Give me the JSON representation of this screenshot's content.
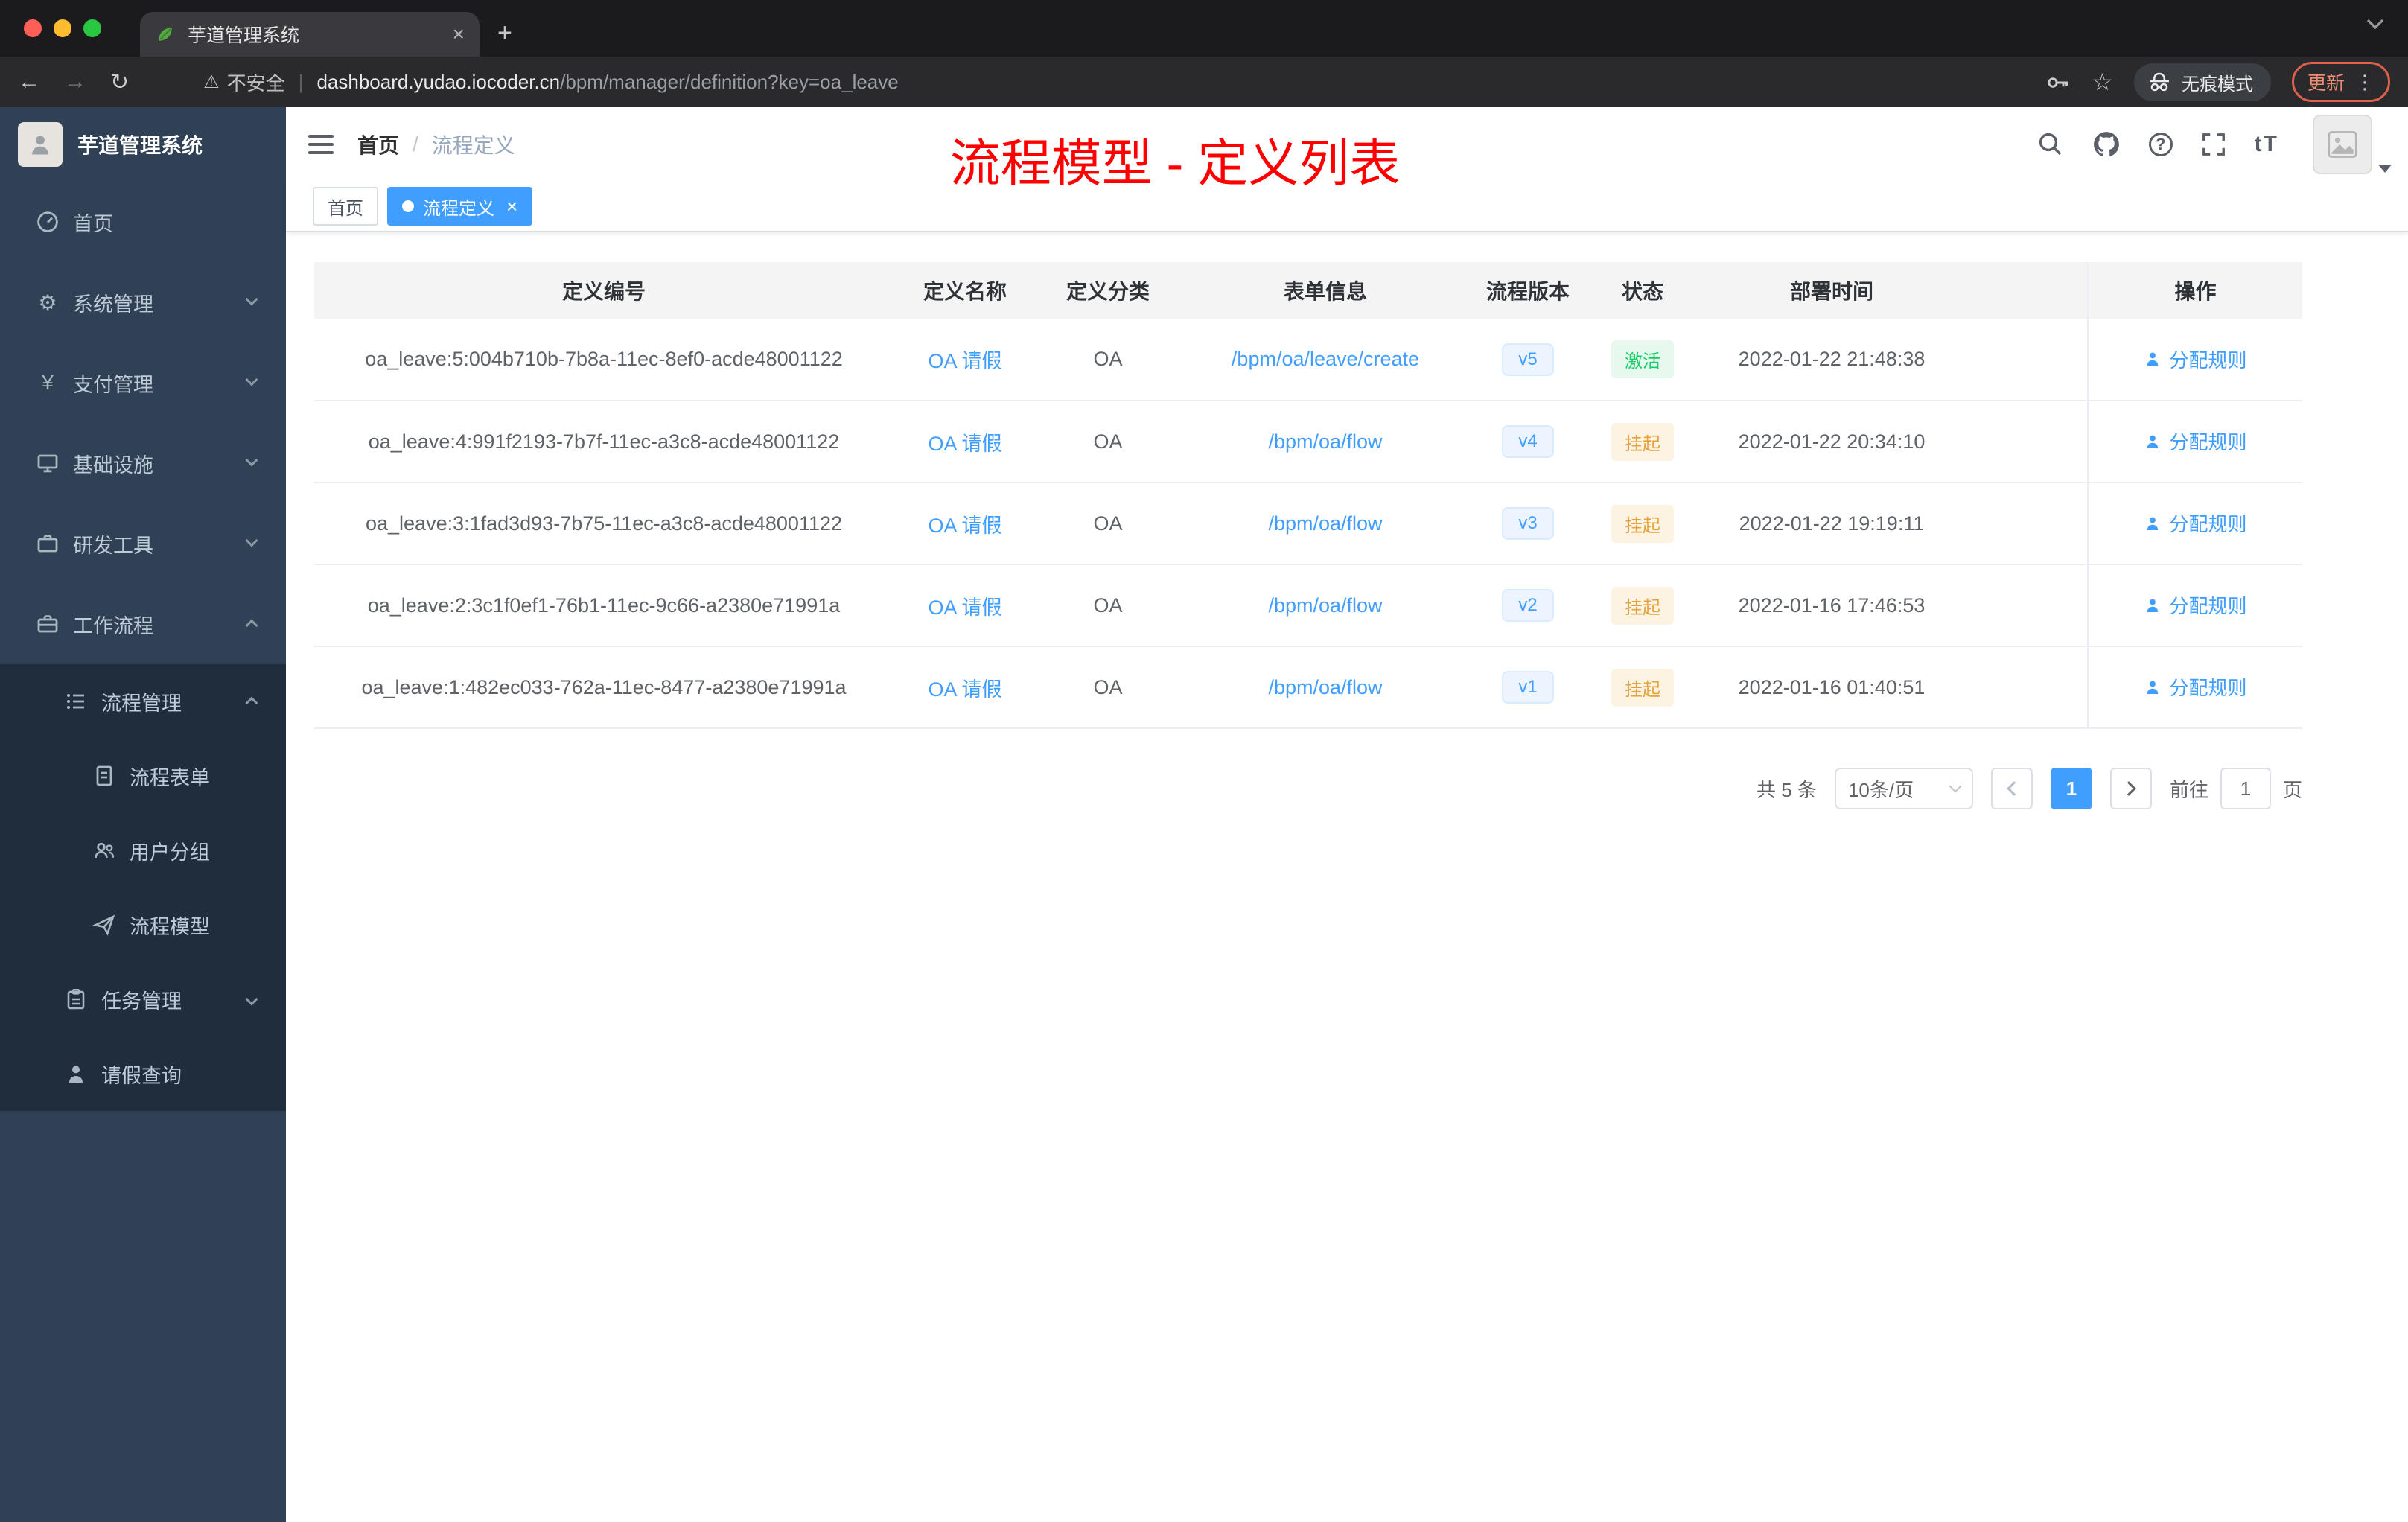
{
  "colors": {
    "primary": "#409eff",
    "success": "#13ce66",
    "warning": "#e6a23c",
    "annotation": "#fe0000",
    "sidebar_bg": "#304156",
    "submenu_bg": "#1f2d3d"
  },
  "browser": {
    "tab_title": "芋道管理系统",
    "security_label": "不安全",
    "url_host": "dashboard.yudao.iocoder.cn",
    "url_path": "/bpm/manager/definition?key=oa_leave",
    "incognito_label": "无痕模式",
    "update_label": "更新"
  },
  "sidebar": {
    "logo_title": "芋道管理系统",
    "items": [
      {
        "label": "首页"
      },
      {
        "label": "系统管理"
      },
      {
        "label": "支付管理"
      },
      {
        "label": "基础设施"
      },
      {
        "label": "研发工具"
      },
      {
        "label": "工作流程"
      },
      {
        "label": "流程管理"
      },
      {
        "label": "流程表单"
      },
      {
        "label": "用户分组"
      },
      {
        "label": "流程模型"
      },
      {
        "label": "任务管理"
      },
      {
        "label": "请假查询"
      }
    ]
  },
  "navbar": {
    "breadcrumb": {
      "home": "首页",
      "separator": "/",
      "current": "流程定义"
    },
    "annotation": "流程模型 - 定义列表",
    "font_icon_label": "tT"
  },
  "tags": {
    "home": "首页",
    "active": "流程定义"
  },
  "table": {
    "columns": [
      "定义编号",
      "定义名称",
      "定义分类",
      "表单信息",
      "流程版本",
      "状态",
      "部署时间",
      "操作"
    ],
    "rows": [
      {
        "id": "oa_leave:5:004b710b-7b8a-11ec-8ef0-acde48001122",
        "name": "OA 请假",
        "category": "OA",
        "form": "/bpm/oa/leave/create",
        "version": "v5",
        "status": "激活",
        "status_type": "success",
        "time": "2022-01-22 21:48:38",
        "action": "分配规则"
      },
      {
        "id": "oa_leave:4:991f2193-7b7f-11ec-a3c8-acde48001122",
        "name": "OA 请假",
        "category": "OA",
        "form": "/bpm/oa/flow",
        "version": "v4",
        "status": "挂起",
        "status_type": "warning",
        "time": "2022-01-22 20:34:10",
        "action": "分配规则"
      },
      {
        "id": "oa_leave:3:1fad3d93-7b75-11ec-a3c8-acde48001122",
        "name": "OA 请假",
        "category": "OA",
        "form": "/bpm/oa/flow",
        "version": "v3",
        "status": "挂起",
        "status_type": "warning",
        "time": "2022-01-22 19:19:11",
        "action": "分配规则"
      },
      {
        "id": "oa_leave:2:3c1f0ef1-76b1-11ec-9c66-a2380e71991a",
        "name": "OA 请假",
        "category": "OA",
        "form": "/bpm/oa/flow",
        "version": "v2",
        "status": "挂起",
        "status_type": "warning",
        "time": "2022-01-16 17:46:53",
        "action": "分配规则"
      },
      {
        "id": "oa_leave:1:482ec033-762a-11ec-8477-a2380e71991a",
        "name": "OA 请假",
        "category": "OA",
        "form": "/bpm/oa/flow",
        "version": "v1",
        "status": "挂起",
        "status_type": "warning",
        "time": "2022-01-16 01:40:51",
        "action": "分配规则"
      }
    ]
  },
  "pagination": {
    "total": "共 5 条",
    "page_size": "10条/页",
    "current_page": "1",
    "goto_label": "前往",
    "goto_value": "1",
    "unit_label": "页"
  }
}
